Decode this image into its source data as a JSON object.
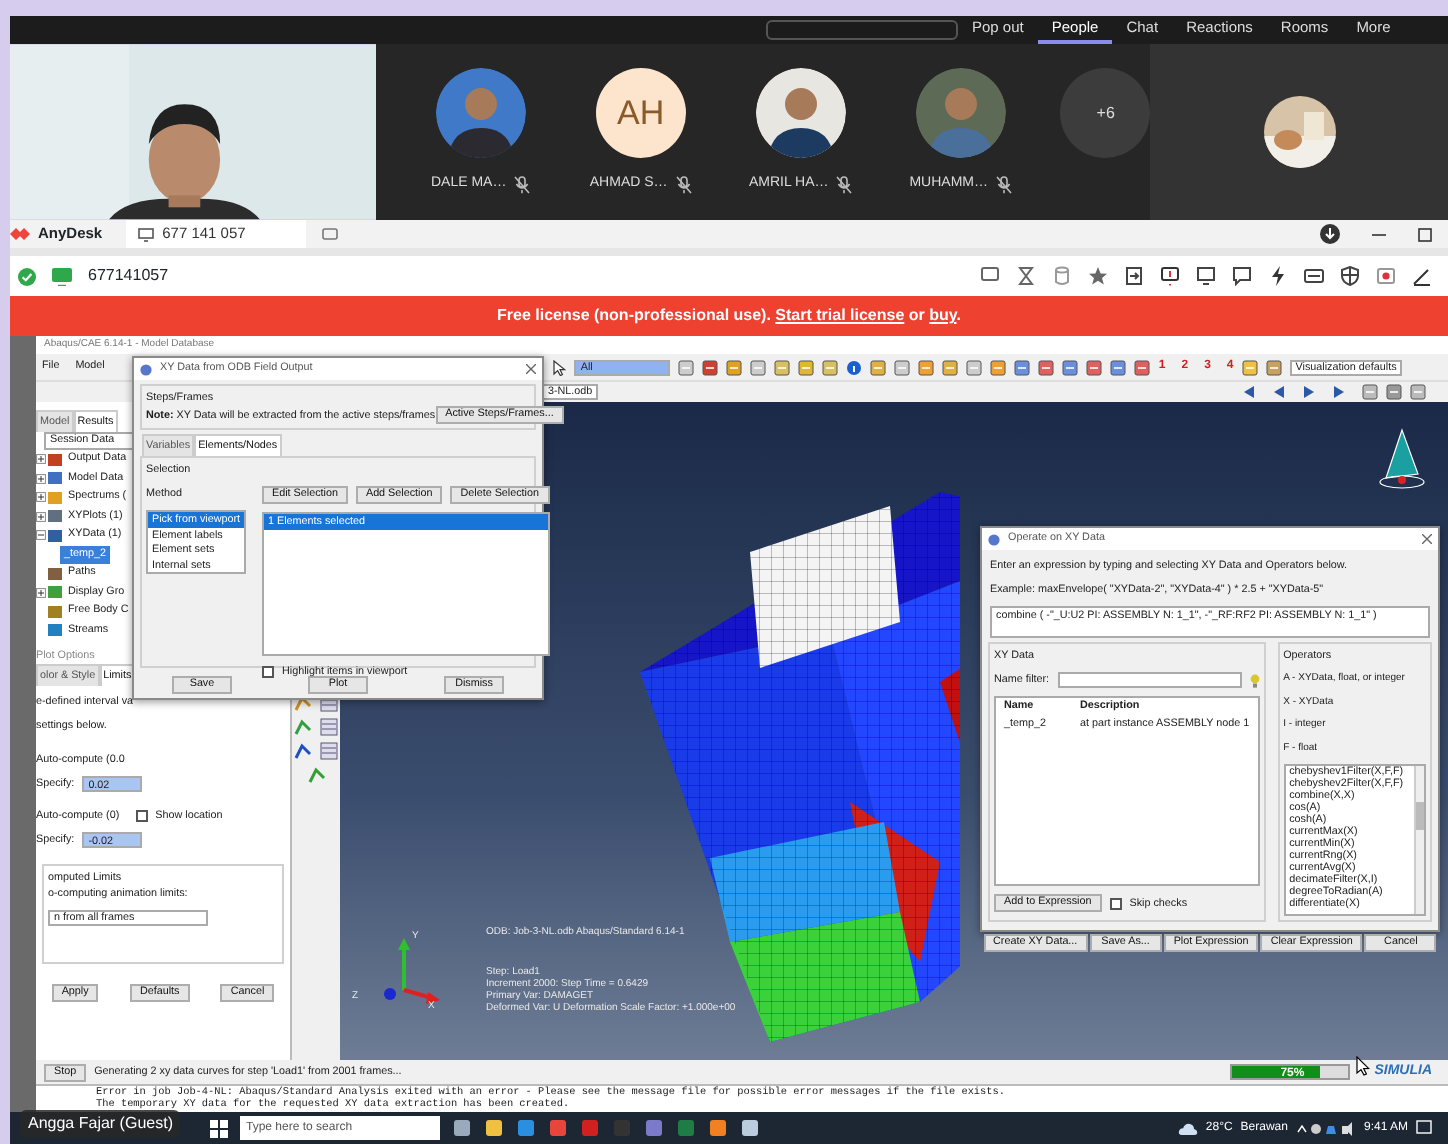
{
  "meeting": {
    "tabs": [
      {
        "label": "Pop out",
        "selected": false
      },
      {
        "label": "People",
        "selected": true
      },
      {
        "label": "Chat",
        "selected": false
      },
      {
        "label": "Reactions",
        "selected": false
      },
      {
        "label": "Rooms",
        "selected": false
      },
      {
        "label": "More",
        "selected": false
      }
    ],
    "participants": [
      {
        "name": "DALE MA…",
        "muted": true
      },
      {
        "name": "AHMAD S…",
        "kind": "initials",
        "initials": "AH",
        "muted": true
      },
      {
        "name": "AMRIL HA…",
        "muted": true
      },
      {
        "name": "MUHAMM…",
        "muted": true
      }
    ],
    "more_count": "+6",
    "guest_label": "Angga Fajar (Guest)"
  },
  "anydesk": {
    "app_name": "AnyDesk",
    "tab_label": "677 141 057",
    "address": "677141057",
    "banner": [
      {
        "text": "Free license (non-professional use). ",
        "link": false
      },
      {
        "text": "Start trial license",
        "link": true
      },
      {
        "text": " or ",
        "link": false
      },
      {
        "text": "buy",
        "link": true
      },
      {
        "text": ".",
        "link": false
      }
    ]
  },
  "abaqus": {
    "title": "Abaqus/CAE 6.14-1 - Model Database",
    "menu": [
      "File",
      "Model"
    ],
    "selection_filter": "All",
    "view_numbers": [
      "1",
      "2",
      "3",
      "4"
    ],
    "visualization": "Visualization defaults",
    "odb": "3-NL.odb",
    "module_tabs": [
      {
        "label": "Model",
        "selected": false
      },
      {
        "label": "Results",
        "selected": true
      }
    ],
    "session": "Session Data",
    "tree": [
      {
        "label": "Output Data",
        "expanded": false,
        "selected": false
      },
      {
        "label": "Model Data",
        "expanded": false,
        "selected": false
      },
      {
        "label": "Spectrums (",
        "expanded": false,
        "selected": false
      },
      {
        "label": "XYPlots (1)",
        "expanded": false,
        "selected": false
      },
      {
        "label": "XYData (1)",
        "expanded": true,
        "selected": false,
        "children": [
          {
            "label": "_temp_2",
            "selected": true
          }
        ]
      },
      {
        "label": "Paths",
        "selected": false
      },
      {
        "label": "Display Gro",
        "expanded": false,
        "selected": false
      },
      {
        "label": "Free Body C",
        "selected": false
      },
      {
        "label": "Streams",
        "selected": false
      }
    ],
    "plot_options": {
      "title": "Plot Options",
      "tabs": [
        {
          "label": "olor & Style",
          "selected": false
        },
        {
          "label": "Limits",
          "selected": true
        }
      ],
      "lines": [
        "e-defined interval va",
        "settings below."
      ],
      "rows": [
        {
          "auto": "Auto-compute (0.0",
          "specify": "Specify:",
          "value": "0.02"
        },
        {
          "auto": "Auto-compute (0)",
          "specify": "Specify:",
          "value": "-0.02",
          "show_location": {
            "label": "Show location",
            "checked": false
          }
        }
      ],
      "computed_title": "omputed Limits",
      "computed_text": "o-computing animation limits:",
      "frames_select": "n from all frames",
      "buttons": [
        "Apply",
        "Defaults",
        "Cancel"
      ]
    },
    "xy_dialog": {
      "title": "XY Data from ODB Field Output",
      "group": "Steps/Frames",
      "note": "**Note:** XY Data will be extracted from the active steps/frames",
      "steps_button": "Active Steps/Frames...",
      "tabs": [
        {
          "label": "Variables",
          "selected": false
        },
        {
          "label": "Elements/Nodes",
          "selected": true
        }
      ],
      "selection_group": "Selection",
      "method_label": "Method",
      "methods": [
        {
          "label": "Pick from viewport",
          "selected": true
        },
        {
          "label": "Element labels",
          "selected": false
        },
        {
          "label": "Element sets",
          "selected": false
        },
        {
          "label": "Internal sets",
          "selected": false
        }
      ],
      "actions": [
        "Edit Selection",
        "Add Selection",
        "Delete Selection"
      ],
      "selected_items": [
        {
          "label": "1 Elements selected",
          "selected": true
        }
      ],
      "highlight": {
        "label": "Highlight items in viewport",
        "checked": false
      },
      "buttons": [
        "Save",
        "Plot",
        "Dismiss"
      ]
    },
    "viewport": {
      "odb_line": "ODB: Job-3-NL.odb    Abaqus/Standard 6.14-1",
      "legend": [
        "Step: Load1",
        "Increment   2000: Step Time =   0.6429",
        "Primary Var: DAMAGET",
        "Deformed Var: U   Deformation Scale Factor: +1.000e+00"
      ],
      "axes": [
        "Y",
        "Z",
        "X"
      ]
    },
    "operate_dialog": {
      "title": "Operate on XY Data",
      "instructions": "Enter an expression by typing and selecting XY Data and Operators below.",
      "example": "Example: maxEnvelope( \"XYData-2\", \"XYData-4\" ) * 2.5 + \"XYData-5\"",
      "expression": "combine ( -\"_U:U2 PI: ASSEMBLY N: 1_1\", -\"_RF:RF2 PI: ASSEMBLY N: 1_1\" )",
      "xy_group": "XY Data",
      "filter_label": "Name filter:",
      "columns": [
        "Name",
        "Description"
      ],
      "rows": [
        [
          "_temp_2",
          "at part instance ASSEMBLY node 1"
        ]
      ],
      "operators_group": "Operators",
      "legend": [
        "A - XYData, float, or integer",
        "X - XYData",
        "I - integer",
        "F - float"
      ],
      "operators": [
        "chebyshev1Filter(X,F,F)",
        "chebyshev2Filter(X,F,F)",
        "combine(X,X)",
        "cos(A)",
        "cosh(A)",
        "currentMax(X)",
        "currentMin(X)",
        "currentRng(X)",
        "currentAvg(X)",
        "decimateFilter(X,I)",
        "degreeToRadian(A)",
        "differentiate(X)"
      ],
      "add_button": "Add to Expression",
      "skip_checks": {
        "label": "Skip checks",
        "checked": false
      },
      "buttons": [
        "Create XY Data...",
        "Save As...",
        "Plot Expression",
        "Clear Expression",
        "Cancel"
      ]
    },
    "status": {
      "stop": "Stop",
      "message": "Generating 2 xy data curves for step 'Load1' from 2001 frames...",
      "progress": {
        "level": 0.75,
        "label": "75%"
      },
      "brand": "SIMULIA"
    },
    "messages": [
      "Error in job Job-4-NL: Abaqus/Standard Analysis exited with an error - Please see the  message file for possible error messages if the file exists.",
      "The temporary XY data for the requested XY data extraction has been created."
    ]
  },
  "taskbar": {
    "search_placeholder": "Type here to search",
    "temperature": "28°C",
    "weather": "Berawan",
    "time": "9:41 AM"
  }
}
